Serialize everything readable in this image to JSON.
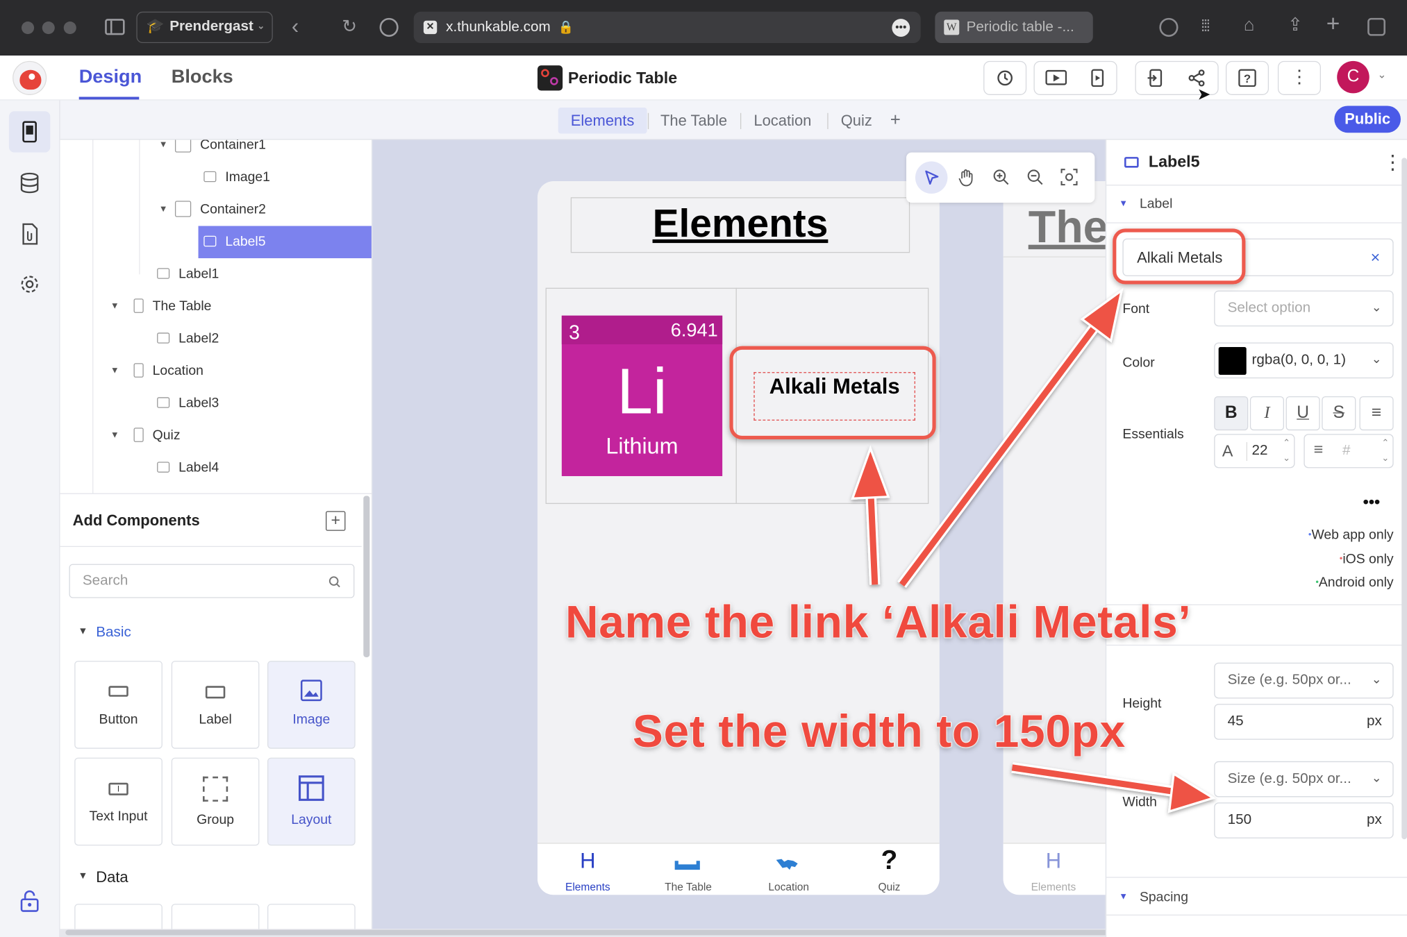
{
  "browser": {
    "profile": "Prendergast",
    "url": "x.thunkable.com",
    "other_tab": "Periodic table -..."
  },
  "header": {
    "tabs": [
      "Design",
      "Blocks"
    ],
    "project_title": "Periodic Table",
    "avatar_letter": "C"
  },
  "screens": {
    "tabs": [
      "Elements",
      "The Table",
      "Location",
      "Quiz"
    ],
    "add_label": "+",
    "public_label": "Public"
  },
  "tree": {
    "items": [
      {
        "label": "Container1",
        "type": "container",
        "level": 2,
        "expanded": true
      },
      {
        "label": "Image1",
        "type": "image",
        "level": 3
      },
      {
        "label": "Container2",
        "type": "container",
        "level": 2,
        "expanded": true
      },
      {
        "label": "Label5",
        "type": "label",
        "level": 3,
        "selected": true
      },
      {
        "label": "Label1",
        "type": "label",
        "level": 1
      },
      {
        "label": "The Table",
        "type": "screen",
        "level": 0,
        "expanded": true
      },
      {
        "label": "Label2",
        "type": "label",
        "level": 1
      },
      {
        "label": "Location",
        "type": "screen",
        "level": 0,
        "expanded": true
      },
      {
        "label": "Label3",
        "type": "label",
        "level": 1
      },
      {
        "label": "Quiz",
        "type": "screen",
        "level": 0,
        "expanded": true
      },
      {
        "label": "Label4",
        "type": "label",
        "level": 1
      }
    ]
  },
  "add_components": {
    "title": "Add Components",
    "search_placeholder": "Search",
    "basic_label": "Basic",
    "data_label": "Data",
    "components": [
      {
        "label": "Button",
        "icon": "button-icon",
        "selected": false
      },
      {
        "label": "Label",
        "icon": "label-icon",
        "selected": false
      },
      {
        "label": "Image",
        "icon": "image-icon",
        "selected": true
      },
      {
        "label": "Text Input",
        "icon": "text-input-icon",
        "selected": false
      },
      {
        "label": "Group",
        "icon": "group-icon",
        "selected": false
      },
      {
        "label": "Layout",
        "icon": "layout-icon",
        "selected": true
      }
    ]
  },
  "phone": {
    "title": "Elements",
    "element": {
      "number": "3",
      "mass": "6.941",
      "symbol": "Li",
      "name": "Lithium",
      "color": "#c3249d"
    },
    "label_text": "Alkali Metals",
    "nav": [
      {
        "label": "Elements",
        "icon": "H",
        "active": true
      },
      {
        "label": "The Table",
        "icon": "table-icon",
        "active": false
      },
      {
        "label": "Location",
        "icon": "world-map-icon",
        "active": false
      },
      {
        "label": "Quiz",
        "icon": "?",
        "active": false
      }
    ]
  },
  "phone2": {
    "title": "The",
    "nav_icon": "H",
    "nav_label": "Elements"
  },
  "props": {
    "component_name": "Label5",
    "section_label": "Label",
    "text_value": "Alkali Metals",
    "clear_label": "×",
    "font_label": "Font",
    "font_placeholder": "Select option",
    "color_label": "Color",
    "color_value": "rgba(0, 0, 0, 1)",
    "essentials_label": "Essentials",
    "format_buttons": [
      "B",
      "I",
      "U",
      "S",
      "≡"
    ],
    "font_size_prefix": "A",
    "font_size": "22",
    "hash_placeholder": "#",
    "more_label": "•••",
    "legend": [
      {
        "label": "Web app only",
        "color": "#5b7cf0"
      },
      {
        "label": "iOS only",
        "color": "#f06a6a"
      },
      {
        "label": "Android only",
        "color": "#3cc470"
      }
    ],
    "height_label": "Height",
    "height_size_placeholder": "Size (e.g. 50px or...",
    "height_value": "45",
    "width_label": "Width",
    "width_size_placeholder": "Size (e.g. 50px or...",
    "width_value": "150",
    "unit": "px",
    "spacing_label": "Spacing"
  },
  "annotations": {
    "line1": "Name the link ‘Alkali Metals’",
    "line2": "Set the width to 150px"
  }
}
